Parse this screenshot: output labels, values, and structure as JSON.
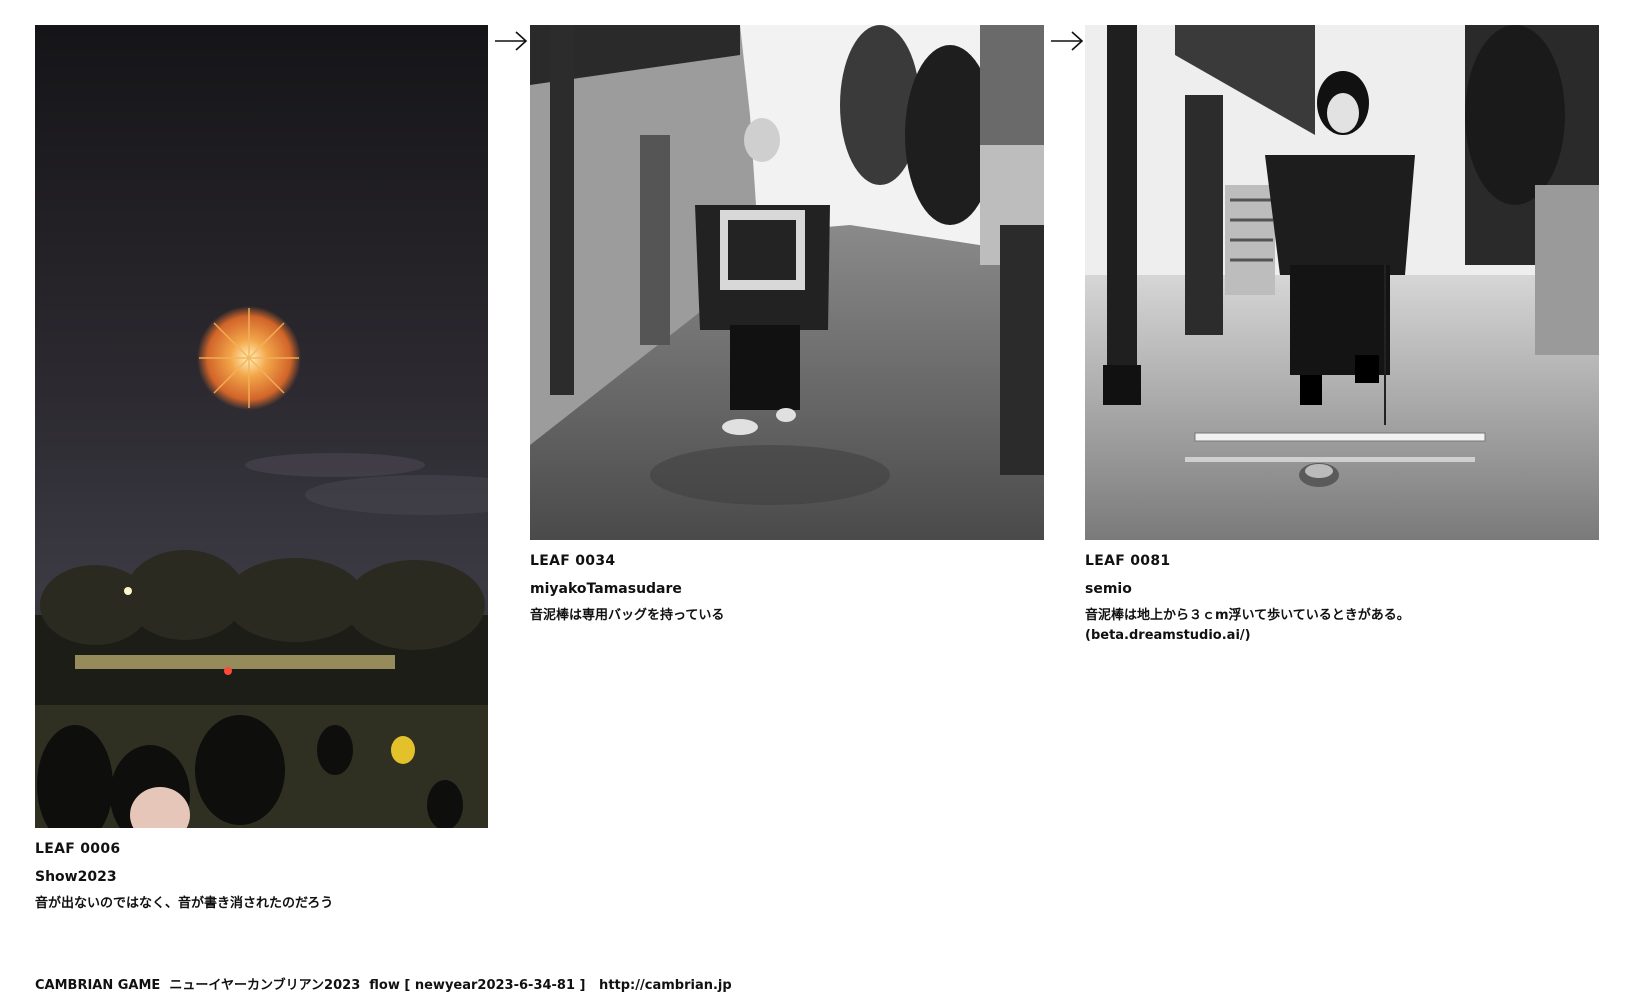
{
  "leaves": [
    {
      "id": "LEAF 0006",
      "author": "Show2023",
      "caption_lines": [
        "音が出ないのではなく、音が書き消されたのだろう"
      ]
    },
    {
      "id": "LEAF 0034",
      "author": "miyakoTamasudare",
      "caption_lines": [
        "音泥棒は専用バッグを持っている"
      ]
    },
    {
      "id": "LEAF 0081",
      "author": "semio",
      "caption_lines": [
        "音泥棒は地上から３ｃm浮いて歩いているときがある。",
        "(beta.dreamstudio.ai/)"
      ]
    }
  ],
  "arrows": [
    "arrow-right-icon",
    "arrow-right-icon"
  ],
  "footer": {
    "text": "CAMBRIAN GAME  ニューイヤーカンブリアン2023  flow [ newyear2023-6-34-81 ]   http://cambrian.jp"
  },
  "colors": {
    "text": "#111111",
    "background": "#ffffff"
  }
}
